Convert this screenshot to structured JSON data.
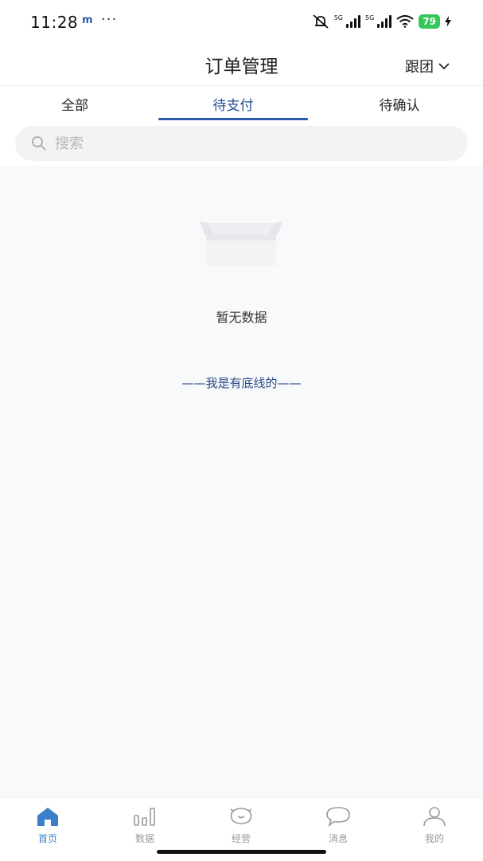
{
  "status_bar": {
    "time": "11:28",
    "app_indicator": "m",
    "more": "···",
    "signal_label_1": "5G",
    "signal_label_2": "5G",
    "battery": "79"
  },
  "header": {
    "title": "订单管理",
    "team_filter": "跟团"
  },
  "tabs": [
    {
      "label": "全部",
      "active": false
    },
    {
      "label": "待支付",
      "active": true
    },
    {
      "label": "待确认",
      "active": false
    }
  ],
  "search": {
    "placeholder": "搜索"
  },
  "empty_state": {
    "message": "暂无数据",
    "bottom_line": "——我是有底线的——"
  },
  "bottom_nav": [
    {
      "label": "首页",
      "icon": "home-icon",
      "active": true
    },
    {
      "label": "数据",
      "icon": "bar-chart-icon",
      "active": false
    },
    {
      "label": "经营",
      "icon": "piggy-bank-icon",
      "active": false
    },
    {
      "label": "消息",
      "icon": "chat-bubble-icon",
      "active": false
    },
    {
      "label": "我的",
      "icon": "user-icon",
      "active": false
    }
  ],
  "colors": {
    "accent": "#2a5ba8",
    "nav_active": "#3a80c8",
    "background": "#f8f9fb",
    "battery": "#34c759"
  }
}
